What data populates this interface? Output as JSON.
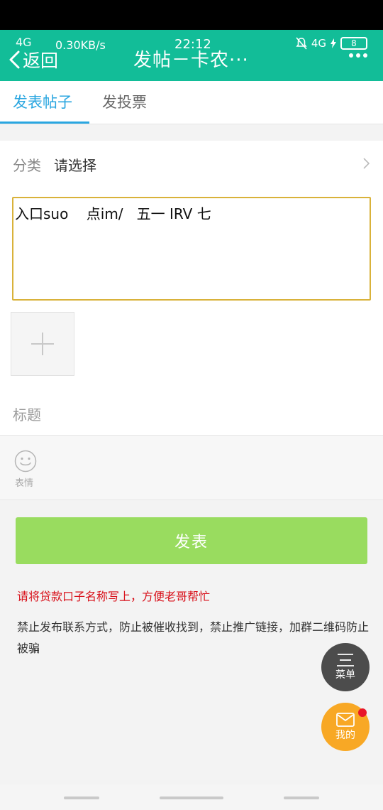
{
  "status_bar": {
    "network": "4G",
    "speed": "0.30KB/s",
    "time": "22:12",
    "network_right": "4G",
    "battery": "8"
  },
  "header": {
    "back_label": "返回",
    "title": "发帖－卡农···"
  },
  "tabs": [
    {
      "label": "发表帖子",
      "active": true
    },
    {
      "label": "发投票",
      "active": false
    }
  ],
  "category": {
    "label": "分类",
    "value": "请选择"
  },
  "editor": {
    "content": "入口suo    点im/   五一 IRV 七"
  },
  "title_field": {
    "placeholder": "标题"
  },
  "emoji": {
    "label": "表情"
  },
  "publish_button": "发表",
  "notice_red": "请将贷款口子名称写上，方便老哥帮忙",
  "notice": "禁止发布联系方式，防止被催收找到，禁止推广链接，加群二维码防止被骗",
  "fab": {
    "menu_label": "菜单",
    "mine_label": "我的"
  },
  "colors": {
    "header": "#12bd98",
    "tab_active": "#2aa6e0",
    "publish": "#99dc5f",
    "notice_red": "#d8101a",
    "fab_mine": "#f8a825"
  }
}
